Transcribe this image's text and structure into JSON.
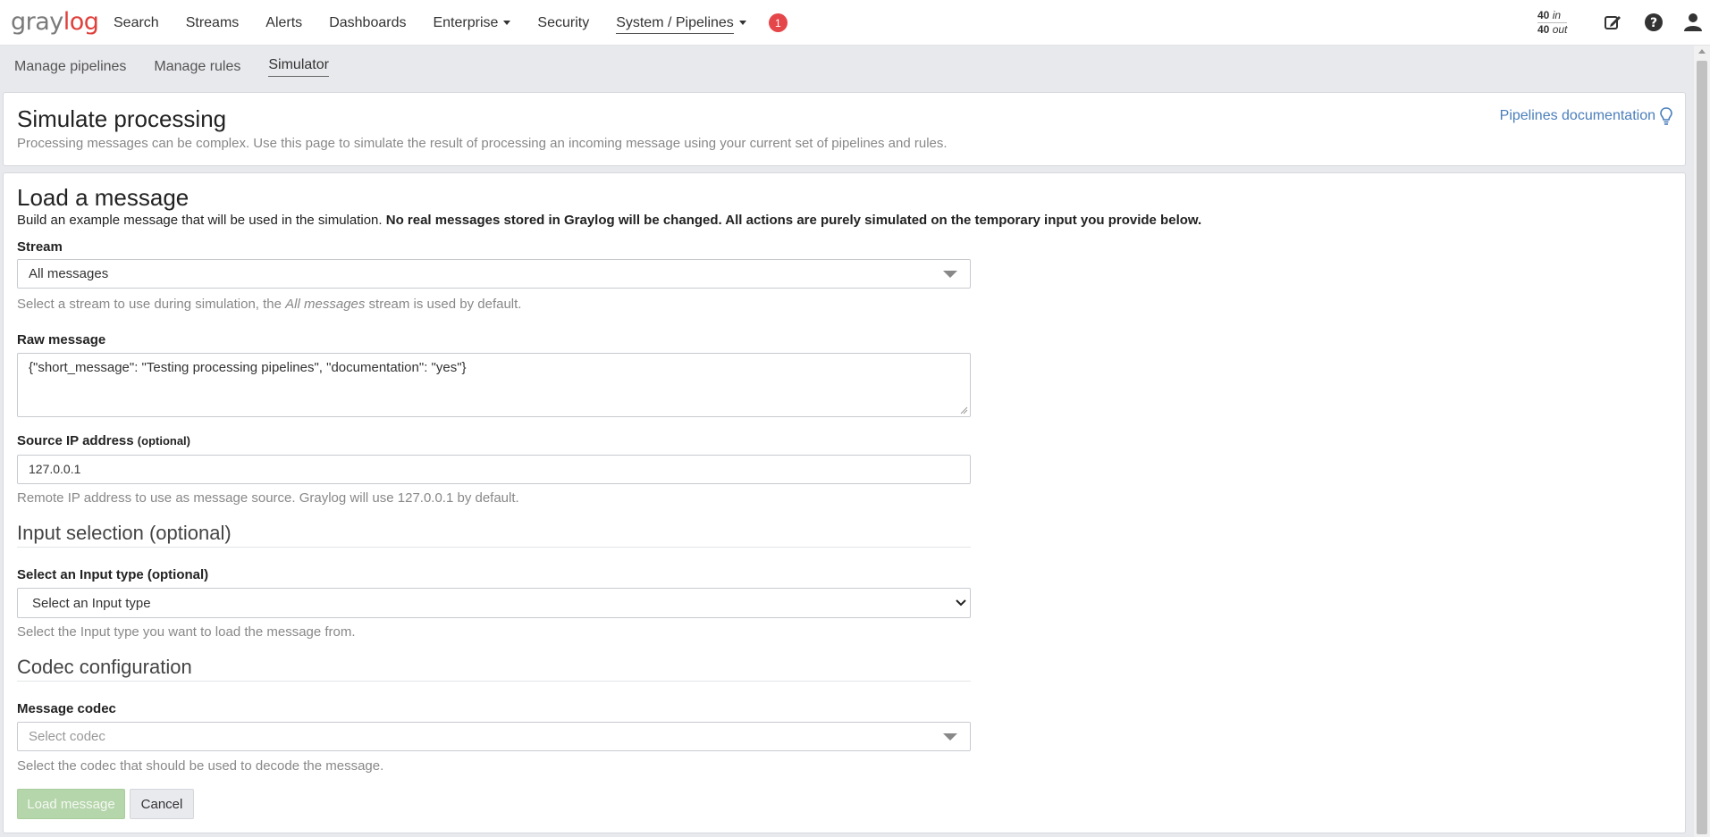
{
  "nav": {
    "logo_gray": "gray",
    "logo_log": "log",
    "items": [
      "Search",
      "Streams",
      "Alerts",
      "Dashboards",
      "Enterprise",
      "Security",
      "System / Pipelines"
    ],
    "notification_count": "1",
    "throughput": {
      "in_value": "40",
      "in_unit": "in",
      "out_value": "40",
      "out_unit": "out"
    }
  },
  "subnav": {
    "items": [
      "Manage pipelines",
      "Manage rules",
      "Simulator"
    ]
  },
  "header": {
    "title": "Simulate processing",
    "description": "Processing messages can be complex. Use this page to simulate the result of processing an incoming message using your current set of pipelines and rules.",
    "doc_link": "Pipelines documentation"
  },
  "load": {
    "title": "Load a message",
    "intro": "Build an example message that will be used in the simulation.",
    "intro_bold": "No real messages stored in Graylog will be changed. All actions are purely simulated on the temporary input you provide below.",
    "stream_label": "Stream",
    "stream_value": "All messages",
    "stream_help_pre": "Select a stream to use during simulation, the",
    "stream_help_em": "All messages",
    "stream_help_post": "stream is used by default.",
    "raw_label": "Raw message",
    "raw_value": "{\"short_message\": \"Testing processing pipelines\", \"documentation\": \"yes\"}",
    "ip_label": "Source IP address",
    "ip_optional": "(optional)",
    "ip_value": "127.0.0.1",
    "ip_help": "Remote IP address to use as message source. Graylog will use 127.0.0.1 by default.",
    "input_section": "Input selection (optional)",
    "input_type_label": "Select an Input type (optional)",
    "input_type_value": "Select an Input type",
    "input_type_help": "Select the Input type you want to load the message from.",
    "codec_section": "Codec configuration",
    "codec_label": "Message codec",
    "codec_placeholder": "Select codec",
    "codec_help": "Select the codec that should be used to decode the message.",
    "load_button": "Load message",
    "cancel_button": "Cancel"
  },
  "colors": {
    "accent_link": "#4a7ebb",
    "badge": "#e5464a",
    "load_button": "#b5d5ab",
    "logo_red": "#e0403c"
  }
}
